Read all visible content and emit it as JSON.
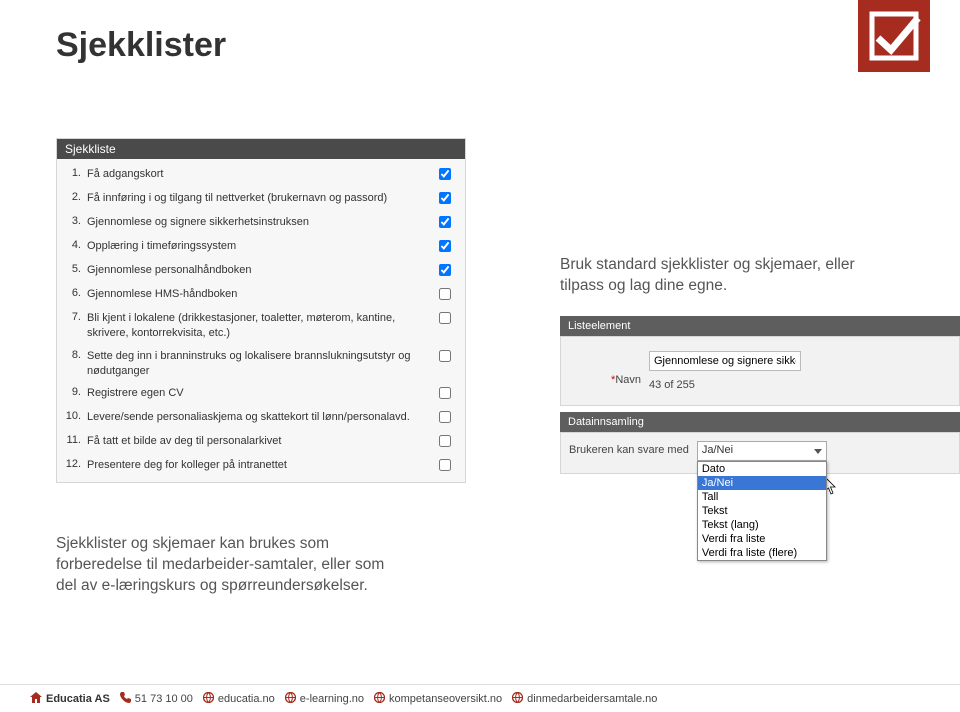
{
  "title": "Sjekklister",
  "checklist": {
    "header": "Sjekkliste",
    "items": [
      {
        "num": "1.",
        "label": "Få adgangskort",
        "checked": true
      },
      {
        "num": "2.",
        "label": "Få innføring i og tilgang til nettverket (brukernavn og passord)",
        "checked": true
      },
      {
        "num": "3.",
        "label": "Gjennomlese og signere sikkerhetsinstruksen",
        "checked": true
      },
      {
        "num": "4.",
        "label": "Opplæring i timeføringssystem",
        "checked": true
      },
      {
        "num": "5.",
        "label": "Gjennomlese personalhåndboken",
        "checked": true
      },
      {
        "num": "6.",
        "label": "Gjennomlese HMS-håndboken",
        "checked": false
      },
      {
        "num": "7.",
        "label": "Bli kjent i lokalene (drikkestasjoner, toaletter, møterom, kantine, skrivere, kontorrekvisita, etc.)",
        "checked": false
      },
      {
        "num": "8.",
        "label": "Sette deg inn i branninstruks og lokalisere brannslukningsutstyr og nødutganger",
        "checked": false
      },
      {
        "num": "9.",
        "label": "Registrere egen CV",
        "checked": false
      },
      {
        "num": "10.",
        "label": "Levere/sende personaliaskjema og skattekort til lønn/personalavd.",
        "checked": false
      },
      {
        "num": "11.",
        "label": "Få tatt et bilde av deg til personalarkivet",
        "checked": false
      },
      {
        "num": "12.",
        "label": "Presentere deg for kolleger på intranettet",
        "checked": false
      }
    ]
  },
  "right_text_1": "Bruk standard sjekklister og skjemaer, eller tilpass og lag dine egne.",
  "right_text_2": "Sjekklister og skjemaer kan brukes som forberedelse til medarbeider-samtaler, eller som del av e-læringskurs og spørreundersøkelser.",
  "listeelement": {
    "header": "Listeelement",
    "navn_label": "Navn",
    "navn_value": "Gjennomlese og signere sikkerhetsinstruksen",
    "char_count": "43 of 255"
  },
  "datainnsamling": {
    "header": "Datainnsamling",
    "prompt": "Brukeren kan svare med",
    "selected": "Ja/Nei",
    "options": [
      "Dato",
      "Ja/Nei",
      "Tall",
      "Tekst",
      "Tekst (lang)",
      "Verdi fra liste",
      "Verdi fra liste (flere)"
    ],
    "highlight_index": 1
  },
  "footer": {
    "company": "Educatia AS",
    "phone": "51 73 10 00",
    "links": [
      "educatia.no",
      "e-learning.no",
      "kompetanseoversikt.no",
      "dinmedarbeidersamtale.no"
    ]
  }
}
